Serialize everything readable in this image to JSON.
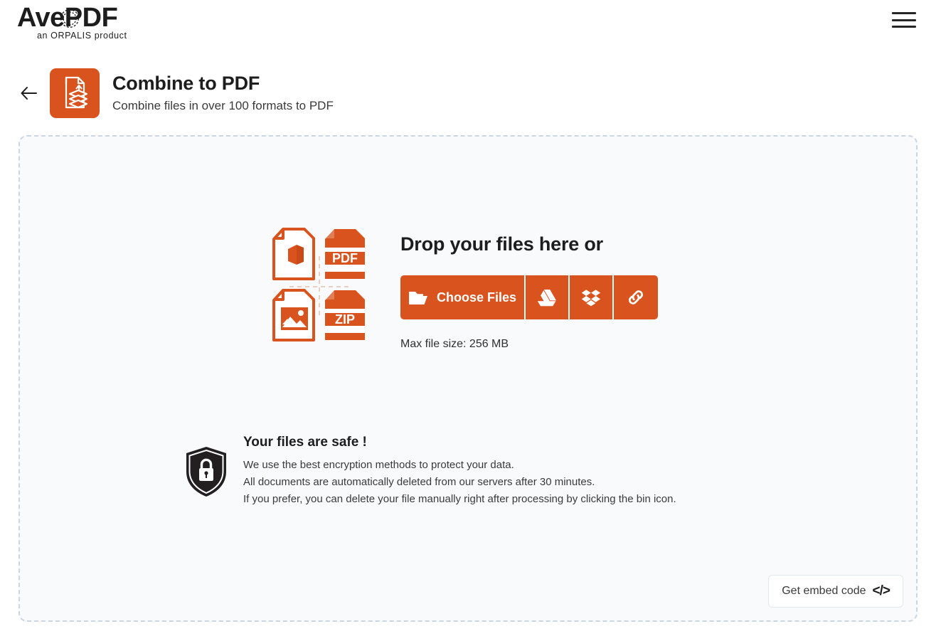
{
  "brand": {
    "name": "AvePDF",
    "tagline": "an ORPALIS product",
    "accent_color": "#d9531e",
    "wreath_icon": "laurel-wreath-icon"
  },
  "topbar": {
    "menu_icon": "hamburger-menu-icon"
  },
  "header": {
    "back_icon": "back-arrow-icon",
    "app_icon": "combine-to-pdf-icon",
    "title": "Combine to PDF",
    "subtitle": "Combine files in over 100 formats to PDF"
  },
  "dropzone": {
    "title": "Drop your files here or",
    "max_file_size": "Max file size: 256 MB",
    "file_types": [
      {
        "name": "office-file-icon",
        "label": ""
      },
      {
        "name": "pdf-file-icon",
        "label": "PDF"
      },
      {
        "name": "image-file-icon",
        "label": ""
      },
      {
        "name": "zip-file-icon",
        "label": "ZIP"
      }
    ],
    "buttons": {
      "choose_files_label": "Choose Files",
      "folder_icon": "folder-open-icon",
      "google_drive_icon": "google-drive-icon",
      "dropbox_icon": "dropbox-icon",
      "url_link_icon": "link-icon"
    }
  },
  "safety": {
    "shield_icon": "shield-lock-icon",
    "title": "Your files are safe !",
    "lines": [
      "We use the best encryption methods to protect your data.",
      "All documents are automatically deleted from our servers after 30 minutes.",
      "If you prefer, you can delete your file manually right after processing by clicking the bin icon."
    ]
  },
  "embed": {
    "label": "Get embed code",
    "glyph": "</>",
    "icon": "code-brackets-icon"
  }
}
